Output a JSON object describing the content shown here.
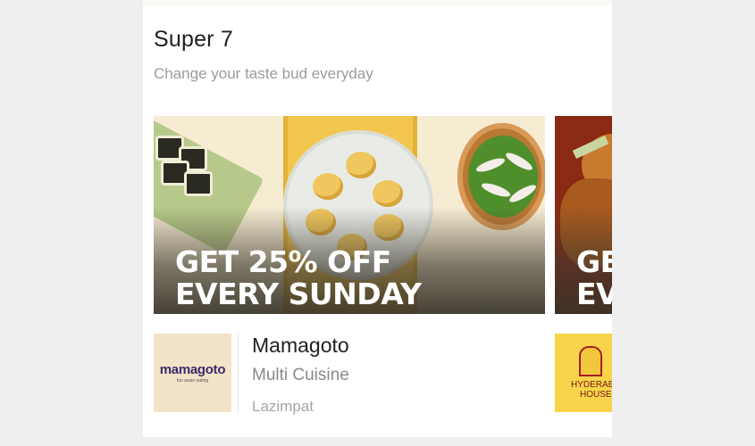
{
  "section": {
    "title": "Super 7",
    "subtitle": "Change your taste bud everyday"
  },
  "cards": [
    {
      "banner_text_line1": "GET 25% OFF",
      "banner_text_line2": "EVERY SUNDAY",
      "logo_text": "mamagoto",
      "logo_tagline": "fun asian eating",
      "name": "Mamagoto",
      "cuisine": "Multi Cuisine",
      "location": "Lazimpat"
    },
    {
      "banner_text_line1": "GE",
      "banner_text_line2": "EV",
      "logo_text_line1": "HYDERABA",
      "logo_text_line2": "HOUSE"
    }
  ],
  "colors": {
    "background": "#efefef",
    "panel": "#ffffff",
    "title": "#1f1f1f",
    "subtitle": "#9b9b9b",
    "banner_text": "#ffffff"
  }
}
